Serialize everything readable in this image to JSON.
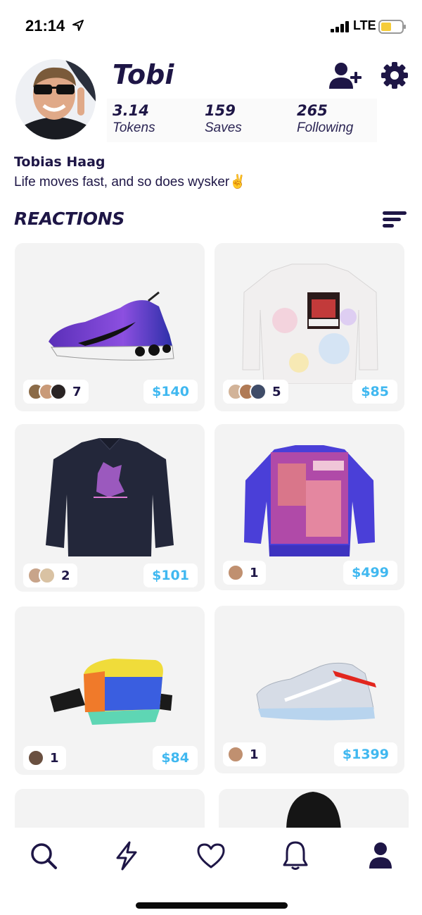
{
  "status_bar": {
    "time": "21:14",
    "network": "LTE"
  },
  "profile": {
    "username": "Tobi",
    "full_name": "Tobias Haag",
    "bio": "Life moves fast, and so does wysker✌️",
    "stats": [
      {
        "value": "3.14",
        "label": "Tokens"
      },
      {
        "value": "159",
        "label": "Saves"
      },
      {
        "value": "265",
        "label": "Following"
      }
    ]
  },
  "section_title": "REACTIONS",
  "products": [
    {
      "item": "sneaker",
      "reactions": "7",
      "price": "$140"
    },
    {
      "item": "tie-dye-sweatshirt",
      "reactions": "5",
      "price": "$85"
    },
    {
      "item": "coach-jacket",
      "reactions": "2",
      "price": "$101"
    },
    {
      "item": "graphic-sweater",
      "reactions": "1",
      "price": "$499"
    },
    {
      "item": "waist-bag",
      "reactions": "1",
      "price": "$84"
    },
    {
      "item": "air-sneaker",
      "reactions": "1",
      "price": "$1399"
    }
  ],
  "tabs": [
    "search-icon",
    "bolt-icon",
    "heart-icon",
    "bell-icon",
    "profile-icon"
  ],
  "colors": {
    "primary": "#1e1646",
    "price": "#40b8f0",
    "card": "#f3f3f3"
  }
}
